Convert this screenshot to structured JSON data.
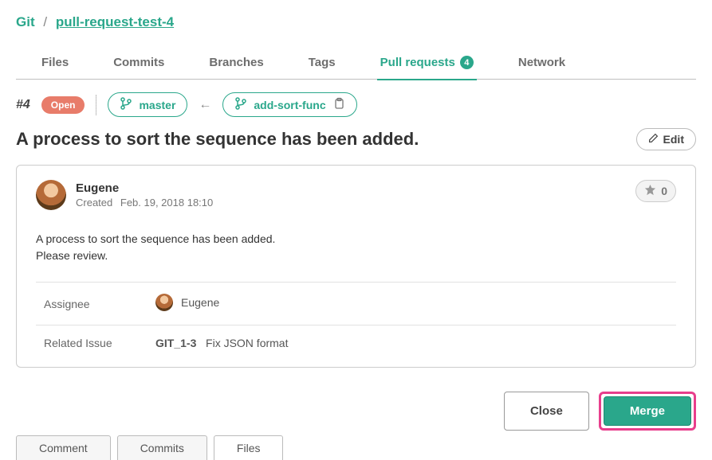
{
  "breadcrumb": {
    "root": "Git",
    "repo": "pull-request-test-4"
  },
  "nav_tabs": {
    "files": "Files",
    "commits": "Commits",
    "branches": "Branches",
    "tags": "Tags",
    "pull_requests": "Pull requests",
    "pull_requests_count": "4",
    "network": "Network"
  },
  "pr": {
    "number": "#4",
    "state": "Open",
    "base_branch": "master",
    "head_branch": "add-sort-func",
    "title": "A process to sort the sequence has been added.",
    "edit_label": "Edit"
  },
  "author": {
    "name": "Eugene",
    "created_label": "Created",
    "created_at": "Feb. 19, 2018 18:10"
  },
  "stars": "0",
  "description_line1": "A process to sort the sequence has been added.",
  "description_line2": "Please review.",
  "meta": {
    "assignee_label": "Assignee",
    "assignee_name": "Eugene",
    "related_label": "Related Issue",
    "related_key": "GIT_1-3",
    "related_title": "Fix JSON format"
  },
  "actions": {
    "close": "Close",
    "merge": "Merge"
  },
  "bottom_tabs": {
    "comment": "Comment",
    "commits": "Commits",
    "files": "Files"
  }
}
